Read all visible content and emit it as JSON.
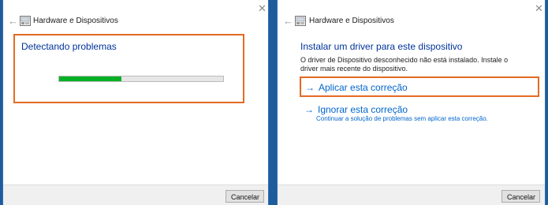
{
  "left_window": {
    "title": "Hardware e Dispositivos",
    "back_glyph": "←",
    "close_glyph": "✕",
    "heading": "Detectando problemas",
    "progress_fraction": 0.38,
    "cancel_label": "Cancelar"
  },
  "right_window": {
    "title": "Hardware e Dispositivos",
    "back_glyph": "←",
    "close_glyph": "✕",
    "heading": "Instalar um driver para este dispositivo",
    "description": "O driver de Dispositivo desconhecido não está instalado. Instale o driver mais recente do dispositivo.",
    "options": [
      {
        "arrow": "→",
        "label": "Aplicar esta correção"
      },
      {
        "arrow": "→",
        "label": "Ignorar esta correção",
        "sublabel": "Continuar a solução de problemas sem aplicar esta correção."
      }
    ],
    "cancel_label": "Cancelar"
  },
  "colors": {
    "accent_blue": "#003399",
    "link_blue": "#0066cc",
    "highlight_orange": "#e36b22",
    "progress_green": "#06b025",
    "desktop_blue": "#1f5c9c"
  },
  "icons": [
    "back-arrow-icon",
    "hardware-devices-icon",
    "close-icon",
    "arrow-right-icon"
  ]
}
